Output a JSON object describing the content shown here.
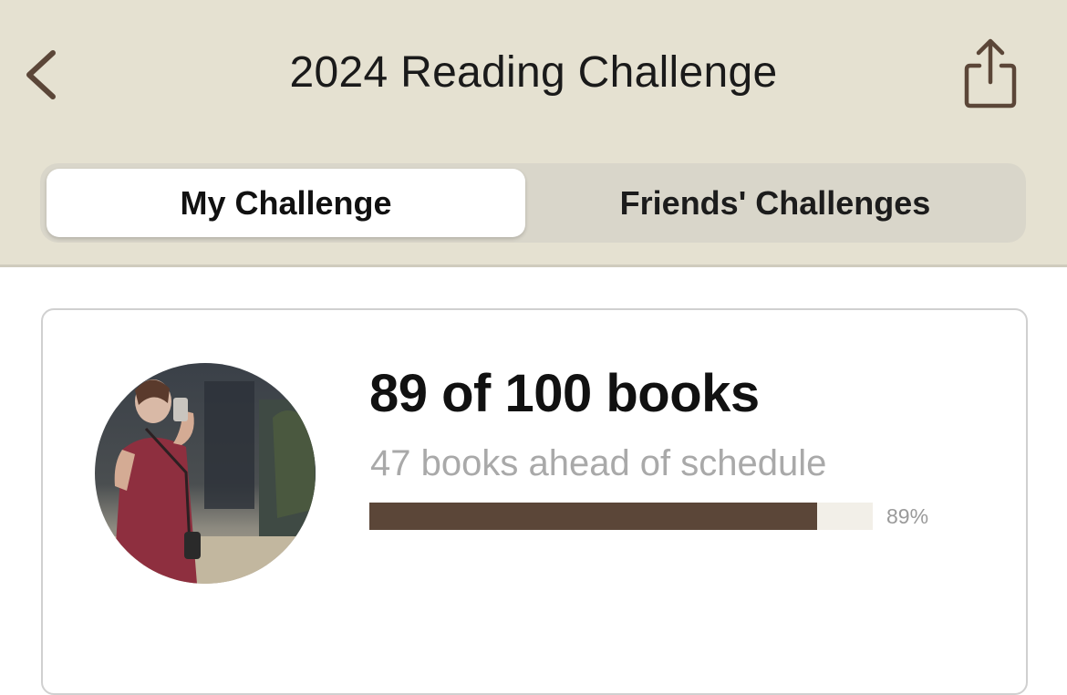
{
  "header": {
    "title": "2024 Reading Challenge",
    "back_icon": "chevron-left-icon",
    "share_icon": "share-icon"
  },
  "tabs": [
    {
      "label": "My Challenge",
      "selected": true
    },
    {
      "label": "Friends' Challenges",
      "selected": false
    }
  ],
  "challenge": {
    "count_text": "89 of 100 books",
    "schedule_text": "47 books ahead of schedule",
    "progress": 0.89,
    "progress_label": "89%"
  },
  "colors": {
    "header_bg": "#e5e1d1",
    "accent_brown": "#5b4638",
    "progress_track": "#f2efe8"
  }
}
